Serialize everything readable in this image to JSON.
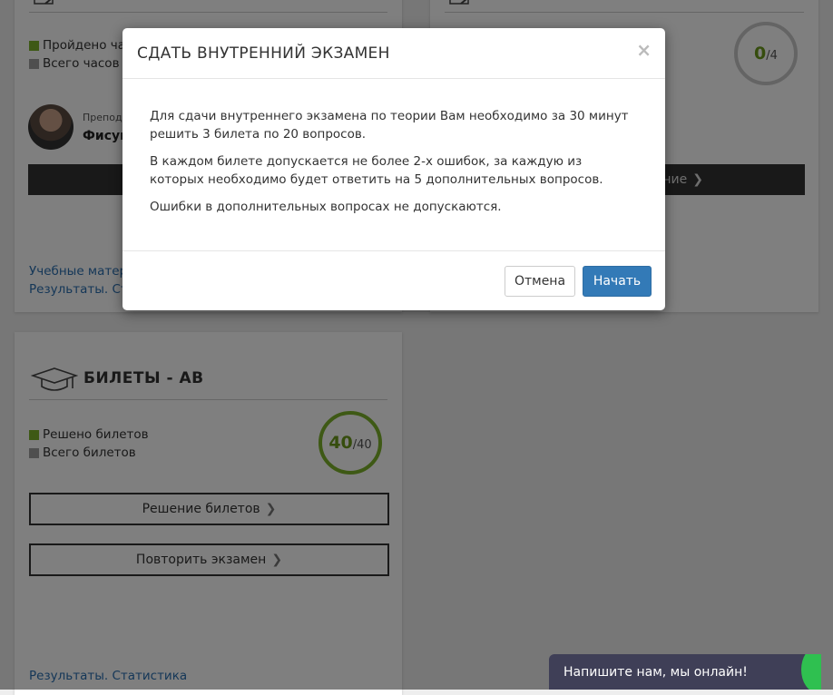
{
  "card_hours": {
    "legend_passed": "Пройдено часов",
    "legend_total": "Всего часов",
    "teacher_label": "Преподаватель",
    "teacher_name": "Фисун",
    "link_materials": "Учебные материалы",
    "link_results": "Результаты. Статистика"
  },
  "card_exam": {
    "ring_value": "0",
    "ring_total": "/4",
    "schedule_button": "Расписание"
  },
  "card_tickets": {
    "title": "БИЛЕТЫ - АВ",
    "legend_solved": "Решено билетов",
    "legend_total": "Всего билетов",
    "ring_value": "40",
    "ring_total": "/40",
    "solve_button": "Решение билетов",
    "repeat_button": "Повторить экзамен",
    "link_results": "Результаты. Статистика"
  },
  "modal": {
    "title": "СДАТЬ ВНУТРЕННИЙ ЭКЗАМЕН",
    "close": "×",
    "paragraph_1": "Для сдачи внутреннего экзамена по теории Вам необходимо за 30 минут решить 3 билета по 20 вопросов.",
    "paragraph_2": "В каждом билете допускается не более 2-х ошибок, за каждую из которых необходимо будет ответить на 5 дополнительных вопросов.",
    "paragraph_3": "Ошибки в дополнительных вопросах не допускаются.",
    "cancel_button": "Отмена",
    "start_button": "Начать"
  },
  "chat": {
    "label": "Напишите нам, мы онлайн!"
  },
  "colors": {
    "accent_green": "#7cb22a",
    "primary_blue": "#337ab7",
    "chat_bg": "#3f3f57"
  }
}
